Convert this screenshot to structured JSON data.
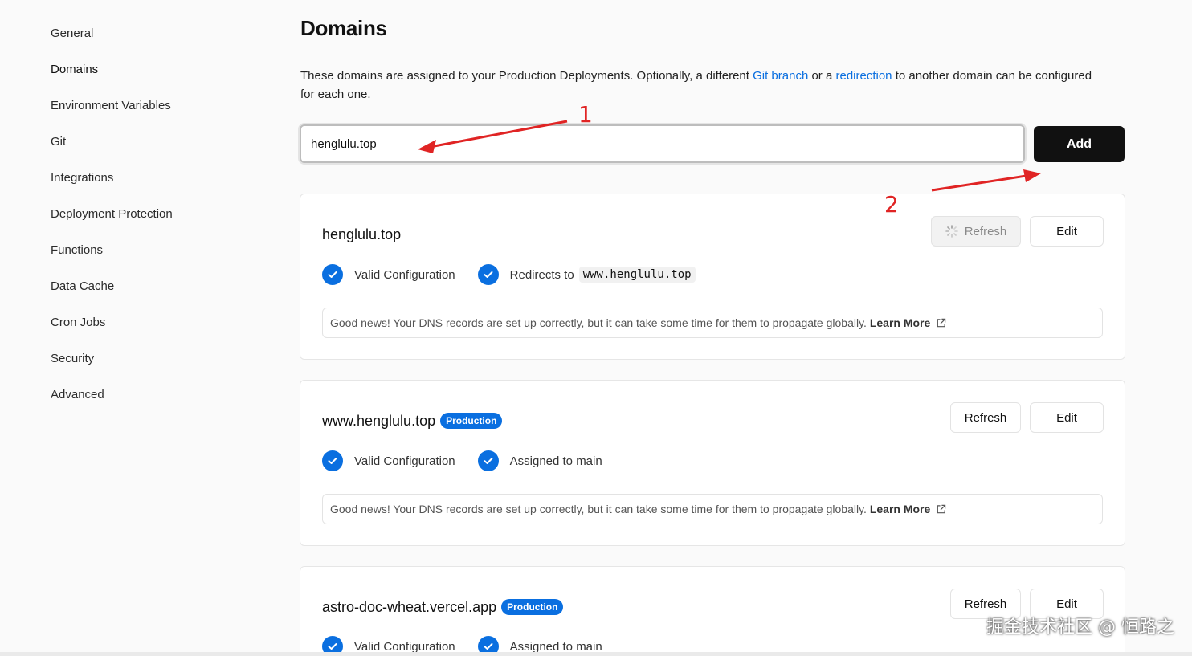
{
  "sidebar": {
    "items": [
      {
        "label": "General"
      },
      {
        "label": "Domains"
      },
      {
        "label": "Environment Variables"
      },
      {
        "label": "Git"
      },
      {
        "label": "Integrations"
      },
      {
        "label": "Deployment Protection"
      },
      {
        "label": "Functions"
      },
      {
        "label": "Data Cache"
      },
      {
        "label": "Cron Jobs"
      },
      {
        "label": "Security"
      },
      {
        "label": "Advanced"
      }
    ],
    "active": "Domains"
  },
  "main": {
    "title": "Domains",
    "description_before": "These domains are assigned to your Production Deployments. Optionally, a different ",
    "git_branch_link": "Git branch",
    "description_mid": " or a ",
    "redirection_link": "redirection",
    "description_after": " to another domain can be configured for each one.",
    "input_value": "henglulu.top",
    "add_label": "Add"
  },
  "domains": [
    {
      "name": "henglulu.top",
      "badge": "",
      "refresh_label": "Refresh",
      "refresh_loading": true,
      "edit_label": "Edit",
      "status1": "Valid Configuration",
      "status2_prefix": "Redirects to",
      "status2_code": "www.henglulu.top",
      "info": "Good news! Your DNS records are set up correctly, but it can take some time for them to propagate globally.",
      "learn_more": "Learn More"
    },
    {
      "name": "www.henglulu.top",
      "badge": "Production",
      "refresh_label": "Refresh",
      "edit_label": "Edit",
      "status1": "Valid Configuration",
      "status2_prefix": "Assigned to main",
      "info": "Good news! Your DNS records are set up correctly, but it can take some time for them to propagate globally.",
      "learn_more": "Learn More"
    },
    {
      "name": "astro-doc-wheat.vercel.app",
      "badge": "Production",
      "refresh_label": "Refresh",
      "edit_label": "Edit",
      "status1": "Valid Configuration",
      "status2_prefix": "Assigned to main"
    }
  ],
  "annotations": {
    "step1": "1",
    "step2": "2",
    "color": "#e02424"
  },
  "watermark": "掘金技术社区 @ 恒路之",
  "colors": {
    "accent": "#0a6fe0",
    "button_dark": "#111111"
  }
}
